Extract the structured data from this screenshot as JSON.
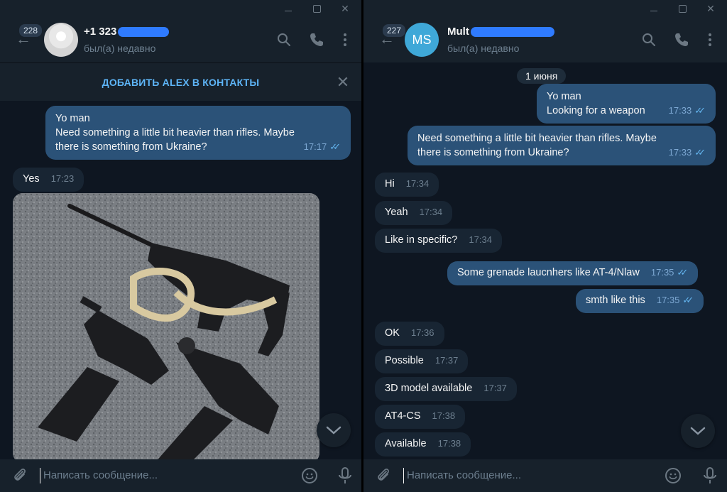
{
  "left": {
    "unread": "228",
    "peer_name": "+1 323",
    "peer_status": "был(а) недавно",
    "banner": "ДОБАВИТЬ ALEX В КОНТАКТЫ",
    "messages": [
      {
        "text": "Yo man\nNeed something a little bit heavier than rifles. Maybe\nthere is something from Ukraine?",
        "time": "17:17"
      },
      {
        "text": "Yes",
        "time": "17:23"
      }
    ],
    "composer_placeholder": "Написать сообщение..."
  },
  "right": {
    "unread": "227",
    "avatar_initials": "MS",
    "peer_name": "Mult",
    "peer_status": "был(а) недавно",
    "date": "1 июня",
    "messages": [
      {
        "text": "Yo man\nLooking for a weapon",
        "time": "17:33"
      },
      {
        "text": "Need something a little bit heavier than rifles. Maybe\nthere is something from Ukraine?",
        "time": "17:33"
      },
      {
        "text": "Hi",
        "time": "17:34"
      },
      {
        "text": "Yeah",
        "time": "17:34"
      },
      {
        "text": "Like in specific?",
        "time": "17:34"
      },
      {
        "text": "Some grenade laucnhers like AT-4/Nlaw",
        "time": "17:35"
      },
      {
        "text": "smth like this",
        "time": "17:35"
      },
      {
        "text": "OK",
        "time": "17:36"
      },
      {
        "text": "Possible",
        "time": "17:37"
      },
      {
        "text": "3D model available",
        "time": "17:37"
      },
      {
        "text": "AT4-CS",
        "time": "17:38"
      },
      {
        "text": "Available",
        "time": "17:38"
      }
    ],
    "composer_placeholder": "Написать сообщение..."
  },
  "colors": {
    "background": "#0e1621",
    "panel": "#17212b",
    "outgoing_bubble": "#2b5278",
    "incoming_bubble": "#182533",
    "accent": "#5eb5f7",
    "redaction": "#2f7bff"
  }
}
